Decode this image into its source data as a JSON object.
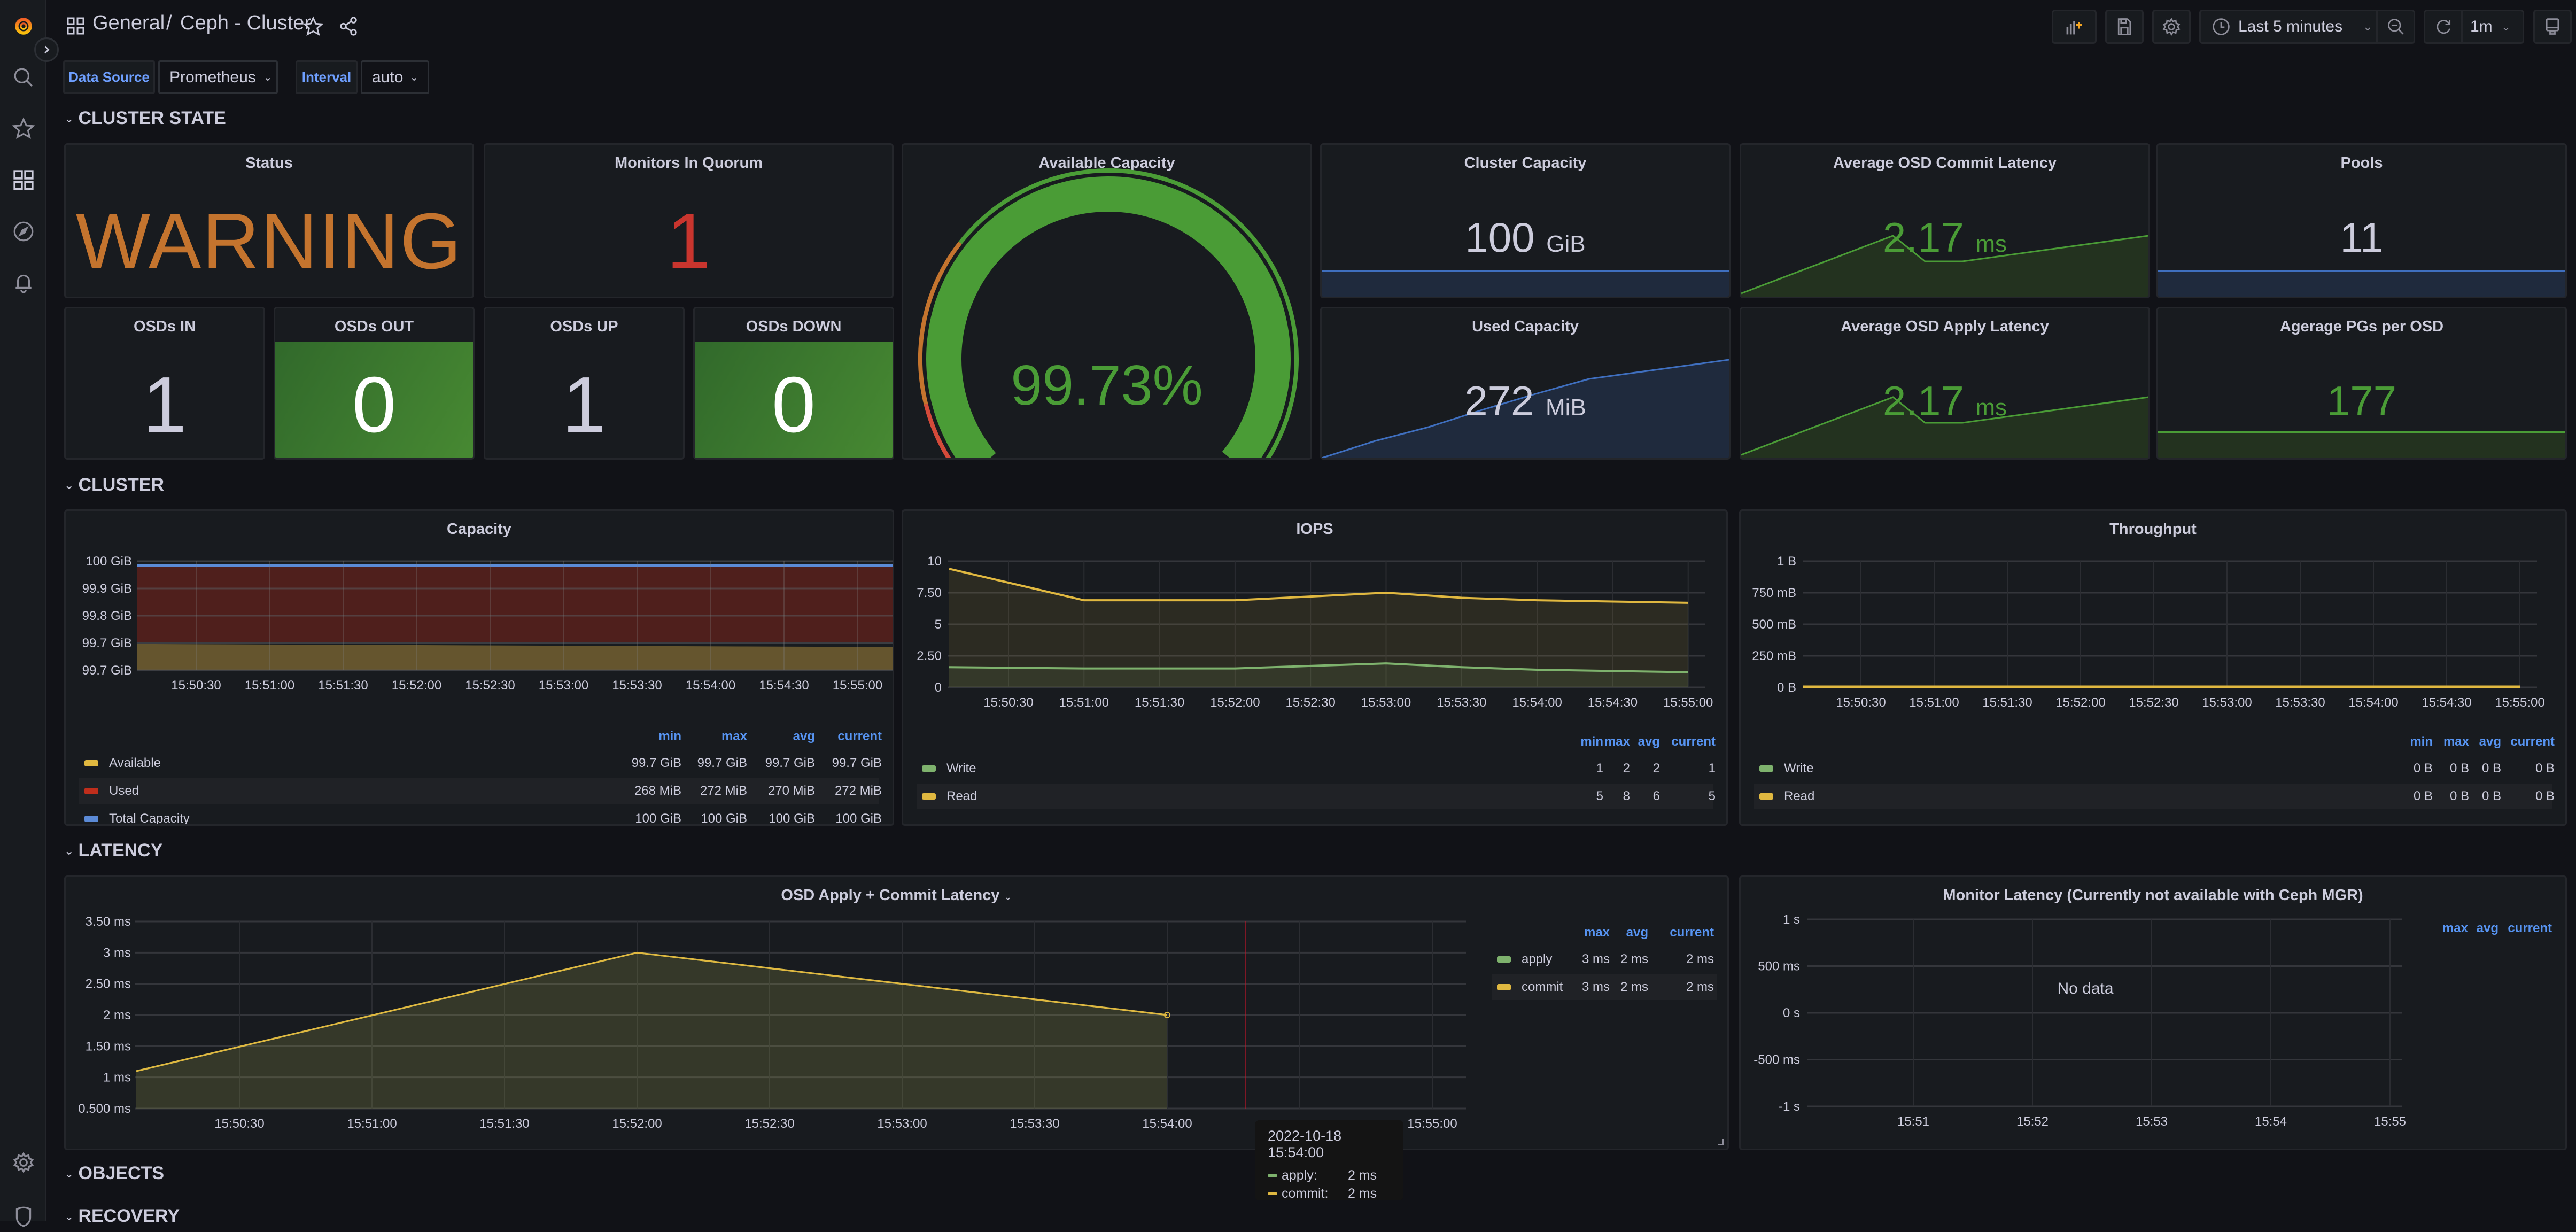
{
  "topbar": {
    "breadcrumb_folder": "General",
    "breadcrumb_separator": "/",
    "dashboard_title": "Ceph - Cluster",
    "time_range": "Last 5 minutes",
    "refresh_interval": "1m"
  },
  "variables": [
    {
      "label": "Data Source",
      "value": "Prometheus"
    },
    {
      "label": "Interval",
      "value": "auto"
    }
  ],
  "sections": {
    "cluster_state": "CLUSTER STATE",
    "cluster": "CLUSTER",
    "latency": "LATENCY",
    "objects": "OBJECTS",
    "recovery": "RECOVERY"
  },
  "colors": {
    "warning": "#c4742e",
    "red": "#c9352e",
    "green": "#4a9c36",
    "blue": "#5b8ad6",
    "yellow": "#e0b840",
    "legend_green": "#7eb26d",
    "used_red": "#bf2e1c",
    "accent_blue": "#5794f2"
  },
  "stats": {
    "status": {
      "title": "Status",
      "value": "WARNING"
    },
    "monitors": {
      "title": "Monitors In Quorum",
      "value": "1"
    },
    "osds_in": {
      "title": "OSDs IN",
      "value": "1"
    },
    "osds_out": {
      "title": "OSDs OUT",
      "value": "0"
    },
    "osds_up": {
      "title": "OSDs UP",
      "value": "1"
    },
    "osds_down": {
      "title": "OSDs DOWN",
      "value": "0"
    },
    "available_capacity": {
      "title": "Available Capacity",
      "value": "99.73%",
      "percent": 99.73,
      "thresholds": [
        {
          "color": "red",
          "upto": 10
        },
        {
          "color": "orange",
          "upto": 30
        },
        {
          "color": "green",
          "upto": 100
        }
      ]
    },
    "cluster_capacity": {
      "title": "Cluster Capacity",
      "value": "100",
      "unit": "GiB"
    },
    "used_capacity": {
      "title": "Used Capacity",
      "value": "272",
      "unit": "MiB"
    },
    "commit_latency": {
      "title": "Average OSD Commit Latency",
      "value": "2.17",
      "unit": "ms"
    },
    "apply_latency": {
      "title": "Average OSD Apply Latency",
      "value": "2.17",
      "unit": "ms"
    },
    "pools": {
      "title": "Pools",
      "value": "11"
    },
    "pgs_per_osd": {
      "title": "Agerage PGs per OSD",
      "value": "177"
    }
  },
  "chart_data": [
    {
      "id": "capacity",
      "type": "area",
      "title": "Capacity",
      "x": [
        "15:50:30",
        "15:51:00",
        "15:51:30",
        "15:52:00",
        "15:52:30",
        "15:53:00",
        "15:53:30",
        "15:54:00",
        "15:54:30",
        "15:55:00"
      ],
      "yticks": [
        "100 GiB",
        "99.9 GiB",
        "99.8 GiB",
        "99.7 GiB",
        "99.7 GiB"
      ],
      "ylim_gib": [
        99.65,
        100
      ],
      "stacked": true,
      "series": [
        {
          "name": "Available",
          "color": "#e0b840",
          "values_gib": [
            99.7343,
            99.7342,
            99.7341,
            99.734,
            99.7339,
            99.7338,
            99.7337,
            99.7336,
            99.7335,
            99.7334
          ],
          "min": "99.7 GiB",
          "max": "99.7 GiB",
          "avg": "99.7 GiB",
          "current": "99.7 GiB"
        },
        {
          "name": "Used",
          "color": "#bf2e1c",
          "values_mib": [
            268,
            268.5,
            269,
            269.5,
            270,
            270.5,
            271,
            271.5,
            272,
            272
          ],
          "min": "268 MiB",
          "max": "272 MiB",
          "avg": "270 MiB",
          "current": "272 MiB"
        },
        {
          "name": "Total Capacity",
          "color": "#5b8ad6",
          "values_gib": [
            100,
            100,
            100,
            100,
            100,
            100,
            100,
            100,
            100,
            100
          ],
          "min": "100 GiB",
          "max": "100 GiB",
          "avg": "100 GiB",
          "current": "100 GiB"
        }
      ],
      "legend_columns": [
        "min",
        "max",
        "avg",
        "current"
      ]
    },
    {
      "id": "iops",
      "type": "line",
      "title": "IOPS",
      "x": [
        "15:50:30",
        "15:51:00",
        "15:51:30",
        "15:52:00",
        "15:52:30",
        "15:53:00",
        "15:53:30",
        "15:54:00",
        "15:54:30",
        "15:55:00"
      ],
      "yticks": [
        "10",
        "7.50",
        "5",
        "2.50",
        "0"
      ],
      "ylim": [
        0,
        10
      ],
      "series": [
        {
          "name": "Write",
          "color": "#7eb26d",
          "points": [
            [
              -0.4,
              1.6
            ],
            [
              1,
              1.5
            ],
            [
              2,
              1.5
            ],
            [
              3,
              1.5
            ],
            [
              4,
              1.7
            ],
            [
              5,
              1.9
            ],
            [
              6,
              1.6
            ],
            [
              7,
              1.4
            ],
            [
              8,
              1.3
            ],
            [
              9,
              1.2
            ]
          ],
          "min": "1",
          "max": "2",
          "avg": "2",
          "current": "1"
        },
        {
          "name": "Read",
          "color": "#e0b840",
          "points": [
            [
              -0.4,
              9.4
            ],
            [
              1,
              6.9
            ],
            [
              2,
              6.9
            ],
            [
              3,
              6.9
            ],
            [
              4,
              7.2
            ],
            [
              5,
              7.5
            ],
            [
              6,
              7.1
            ],
            [
              7,
              6.9
            ],
            [
              8,
              6.8
            ],
            [
              9,
              6.7
            ]
          ],
          "min": "5",
          "max": "8",
          "avg": "6",
          "current": "5"
        }
      ],
      "legend_columns": [
        "min",
        "max",
        "avg",
        "current"
      ]
    },
    {
      "id": "throughput",
      "type": "line",
      "title": "Throughput",
      "x": [
        "15:50:30",
        "15:51:00",
        "15:51:30",
        "15:52:00",
        "15:52:30",
        "15:53:00",
        "15:53:30",
        "15:54:00",
        "15:54:30",
        "15:55:00"
      ],
      "yticks": [
        "1 B",
        "750 mB",
        "500 mB",
        "250 mB",
        "0 B"
      ],
      "ylim": [
        0,
        1
      ],
      "series": [
        {
          "name": "Write",
          "color": "#7eb26d",
          "points": [
            [
              -0.4,
              0
            ],
            [
              9,
              0
            ]
          ],
          "min": "0 B",
          "max": "0 B",
          "avg": "0 B",
          "current": "0 B"
        },
        {
          "name": "Read",
          "color": "#e0b840",
          "points": [
            [
              -0.4,
              0
            ],
            [
              9,
              0
            ]
          ],
          "min": "0 B",
          "max": "0 B",
          "avg": "0 B",
          "current": "0 B"
        }
      ],
      "legend_columns": [
        "min",
        "max",
        "avg",
        "current"
      ]
    },
    {
      "id": "osd_latency",
      "type": "line",
      "title": "OSD Apply + Commit Latency",
      "x": [
        "15:50:30",
        "15:51:00",
        "15:51:30",
        "15:52:00",
        "15:52:30",
        "15:53:00",
        "15:53:30",
        "15:54:00",
        "15:54:30",
        "15:55:00"
      ],
      "yticks": [
        "3.50 ms",
        "3 ms",
        "2.50 ms",
        "2 ms",
        "1.50 ms",
        "1 ms",
        "0.500 ms"
      ],
      "ylim_ms": [
        0.5,
        3.5
      ],
      "series": [
        {
          "name": "apply",
          "color": "#7eb26d",
          "points": [
            [
              -0.8,
              1.1
            ],
            [
              3,
              3
            ],
            [
              7,
              2
            ]
          ],
          "max": "3 ms",
          "avg": "2 ms",
          "current": "2 ms"
        },
        {
          "name": "commit",
          "color": "#e0b840",
          "points": [
            [
              -0.8,
              1.1
            ],
            [
              3,
              3
            ],
            [
              7,
              2
            ]
          ],
          "max": "3 ms",
          "avg": "2 ms",
          "current": "2 ms"
        }
      ],
      "legend_columns": [
        "max",
        "avg",
        "current"
      ],
      "tooltip": {
        "time": "2022-10-18 15:54:00",
        "rows": [
          {
            "name": "apply:",
            "value": "2 ms",
            "color": "#7eb26d"
          },
          {
            "name": "commit:",
            "value": "2 ms",
            "color": "#e0b840"
          }
        ]
      }
    },
    {
      "id": "monitor_latency",
      "type": "line",
      "title": "Monitor Latency (Currently not available with Ceph MGR)",
      "x": [
        "15:51",
        "15:52",
        "15:53",
        "15:54",
        "15:55"
      ],
      "yticks": [
        "1 s",
        "500 ms",
        "0 s",
        "-500 ms",
        "-1 s"
      ],
      "ylim_s": [
        -1,
        1
      ],
      "series": [],
      "no_data_text": "No data",
      "legend_columns": [
        "max",
        "avg",
        "current"
      ]
    }
  ]
}
